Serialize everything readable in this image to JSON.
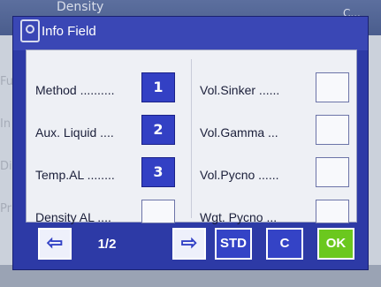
{
  "background": {
    "title": "Density",
    "title_right": "C...",
    "side_items": [
      "Fu",
      "In",
      "Di",
      "Pr"
    ]
  },
  "dialog": {
    "title": "Info Field",
    "left_items": [
      {
        "label": "Method  ..........",
        "value": "1"
      },
      {
        "label": "Aux. Liquid  ....",
        "value": "2"
      },
      {
        "label": "Temp.AL  ........",
        "value": "3"
      },
      {
        "label": "Density  AL  ....",
        "value": ""
      }
    ],
    "right_items": [
      {
        "label": "Vol.Sinker  ......",
        "value": ""
      },
      {
        "label": "Vol.Gamma  ...",
        "value": ""
      },
      {
        "label": "Vol.Pycno  ......",
        "value": ""
      },
      {
        "label": "Wgt. Pycno  ...",
        "value": ""
      }
    ],
    "footer": {
      "prev_glyph": "⇦",
      "page": "1/2",
      "next_glyph": "⇨",
      "std_label": "STD",
      "c_label": "C",
      "ok_label": "OK"
    }
  },
  "colors": {
    "dialog_blue": "#2d3aa6",
    "slot_blue": "#3340c4",
    "ok_green": "#6bc81e",
    "content_bg": "#eef0f5"
  }
}
